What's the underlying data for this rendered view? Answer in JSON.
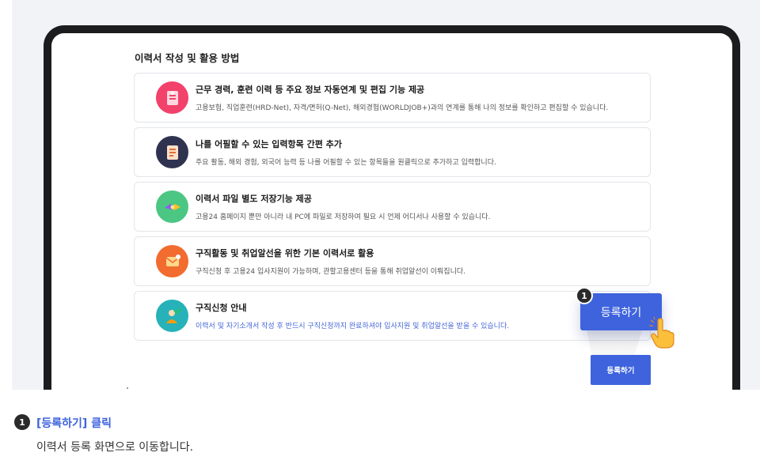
{
  "section_title": "이력서 작성 및 활용 방법",
  "cards": [
    {
      "title": "근무 경력, 훈련 이력 등 주요 정보 자동연계 및 편집 기능 제공",
      "desc": "고용보험, 직업훈련(HRD-Net), 자격/면허(Q-Net), 해외경험(WORLDJOB+)과의 연계를 통해 나의 정보를 확인하고 편집할 수 있습니다.",
      "icon": "document-icon",
      "icon_bg": "#f2416a"
    },
    {
      "title": "나를 어필할 수 있는 입력항목 간편 추가",
      "desc": "주요 활동, 해외 경험, 외국어 능력 등 나를 어필할 수 있는 항목들을 원클릭으로 추가하고 입력합니다.",
      "icon": "notebook-icon",
      "icon_bg": "#2f3350"
    },
    {
      "title": "이력서 파일 별도 저장기능 제공",
      "desc": "고용24 홈페이지 뿐만 아니라 내 PC에 파일로 저장하여 필요 시 언제 어디서나 사용할 수 있습니다.",
      "icon": "handshake-icon",
      "icon_bg": "#4cc683"
    },
    {
      "title": "구직활동 및 취업알선을 위한 기본 이력서로 활용",
      "desc": "구직신청 후 고용24 입사지원이 가능하며, 관할고용센터 등을 통해 취업알선이 이뤄집니다.",
      "icon": "mail-icon",
      "icon_bg": "#f26b2f"
    },
    {
      "title": "구직신청 안내",
      "desc": "이력서 및 자기소개서 작성 후 반드시 구직신청까지 완료하셔야 입사지원 및 취업알선을 받을 수 있습니다.",
      "icon": "person-check-icon",
      "icon_bg": "#26b2b8",
      "desc_color": "#4466d6"
    }
  ],
  "register_button_large": "등록하기",
  "register_button_small": "등록하기",
  "step_badge": "1",
  "instruction": {
    "number": "1",
    "title": "[등록하기] 클릭",
    "desc": "이력서 등록 화면으로 이동합니다."
  },
  "colors": {
    "accent": "#3e63dd",
    "device_frame": "#1c1c1e",
    "background": "#f2f3f6"
  }
}
